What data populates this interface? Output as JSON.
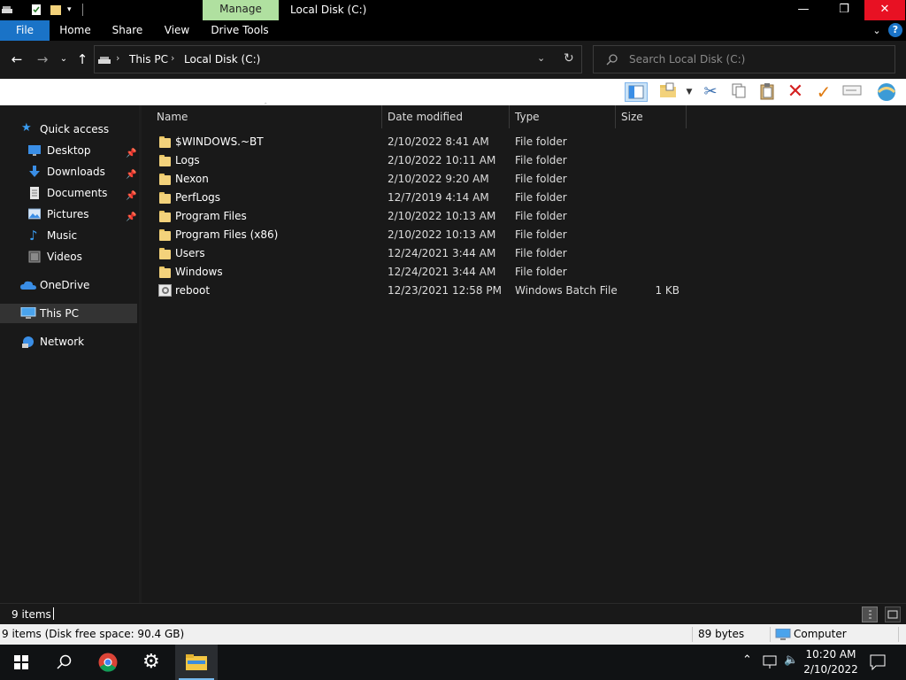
{
  "titlebar": {
    "manage_label": "Manage",
    "window_title": "Local Disk (C:)",
    "controls": {
      "minimize": "—",
      "maximize": "❐",
      "close": "✕"
    }
  },
  "ribbon": {
    "tabs": [
      "File",
      "Home",
      "Share",
      "View",
      "Drive Tools"
    ],
    "help": "?"
  },
  "address": {
    "crumbs": [
      "This PC",
      "Local Disk (C:)"
    ],
    "search_placeholder": "Search Local Disk (C:)"
  },
  "nav_pane": {
    "quick_access": "Quick access",
    "quick_items": [
      {
        "label": "Desktop",
        "pinned": true
      },
      {
        "label": "Downloads",
        "pinned": true
      },
      {
        "label": "Documents",
        "pinned": true
      },
      {
        "label": "Pictures",
        "pinned": true
      },
      {
        "label": "Music",
        "pinned": false
      },
      {
        "label": "Videos",
        "pinned": false
      }
    ],
    "onedrive": "OneDrive",
    "this_pc": "This PC",
    "network": "Network"
  },
  "file_list": {
    "columns": [
      "Name",
      "Date modified",
      "Type",
      "Size"
    ],
    "rows": [
      {
        "name": "$WINDOWS.~BT",
        "date": "2/10/2022 8:41 AM",
        "type": "File folder",
        "size": "",
        "kind": "folder"
      },
      {
        "name": "Logs",
        "date": "2/10/2022 10:11 AM",
        "type": "File folder",
        "size": "",
        "kind": "folder"
      },
      {
        "name": "Nexon",
        "date": "2/10/2022 9:20 AM",
        "type": "File folder",
        "size": "",
        "kind": "folder"
      },
      {
        "name": "PerfLogs",
        "date": "12/7/2019 4:14 AM",
        "type": "File folder",
        "size": "",
        "kind": "folder"
      },
      {
        "name": "Program Files",
        "date": "2/10/2022 10:13 AM",
        "type": "File folder",
        "size": "",
        "kind": "folder"
      },
      {
        "name": "Program Files (x86)",
        "date": "2/10/2022 10:13 AM",
        "type": "File folder",
        "size": "",
        "kind": "folder"
      },
      {
        "name": "Users",
        "date": "12/24/2021 3:44 AM",
        "type": "File folder",
        "size": "",
        "kind": "folder"
      },
      {
        "name": "Windows",
        "date": "12/24/2021 3:44 AM",
        "type": "File folder",
        "size": "",
        "kind": "folder"
      },
      {
        "name": "reboot",
        "date": "12/23/2021 12:58 PM",
        "type": "Windows Batch File",
        "size": "1 KB",
        "kind": "batch"
      }
    ]
  },
  "status": {
    "item_count": "9 items",
    "details_left": "9 items (Disk free space: 90.4 GB)",
    "details_size": "89 bytes",
    "details_location": "Computer"
  },
  "taskbar": {
    "time": "10:20 AM",
    "date": "2/10/2022"
  },
  "colors": {
    "accent": "#1a73c7",
    "manage_tab": "#b0e0a0",
    "close": "#e81123",
    "folder": "#f3d27b"
  }
}
